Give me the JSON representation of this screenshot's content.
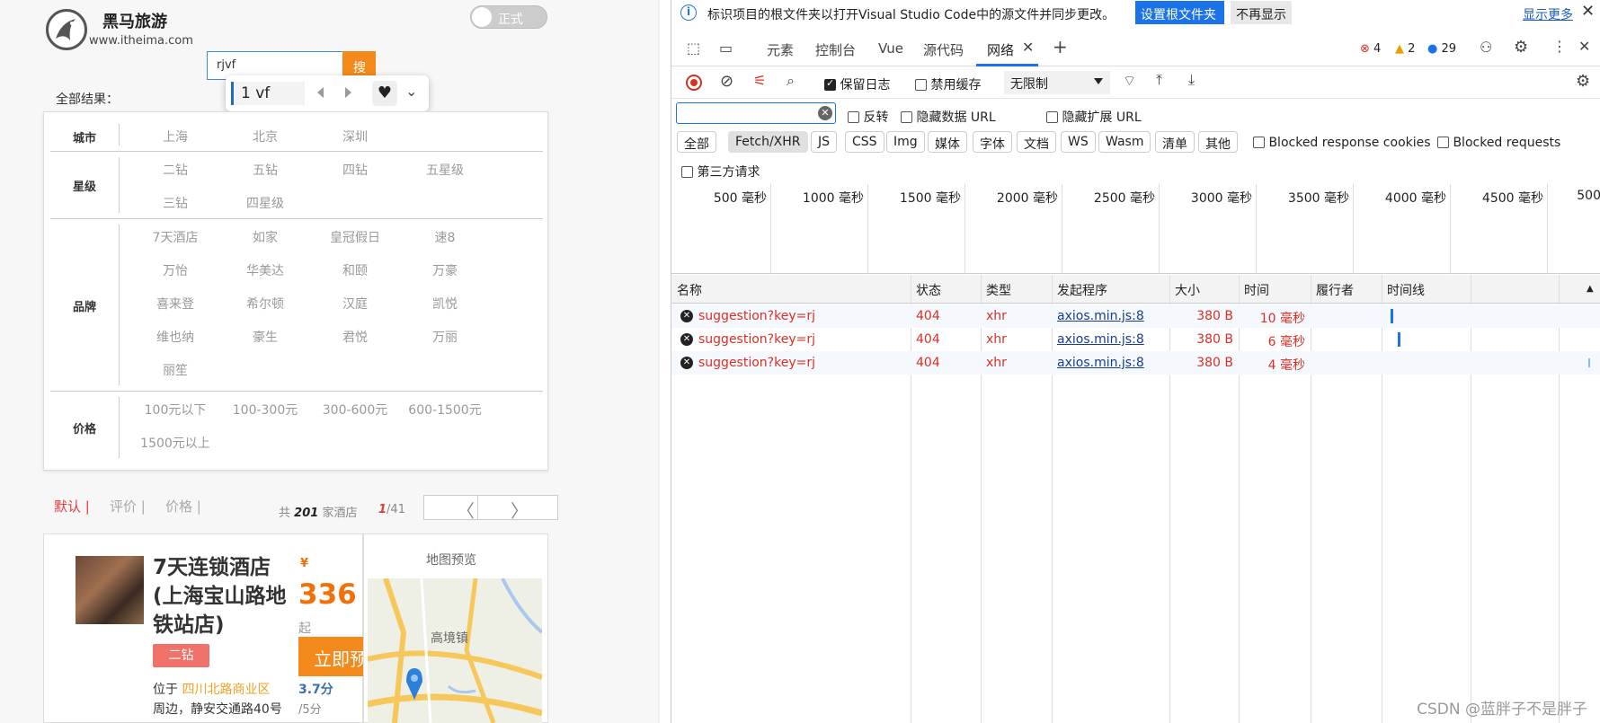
{
  "app": {
    "brand_name": "黑马旅游",
    "brand_url": "www.itheima.com",
    "toggle_label": "正式",
    "search_value": "rjvf",
    "search_button": "搜",
    "find_bar": {
      "text": "1 vf"
    },
    "result_label": "全部结果：",
    "filters": [
      {
        "name": "城市",
        "options": [
          "上海",
          "北京",
          "深圳"
        ]
      },
      {
        "name": "星级",
        "options": [
          "二钻",
          "五钻",
          "四钻",
          "五星级",
          "三钻",
          "四星级"
        ]
      },
      {
        "name": "品牌",
        "options": [
          "7天酒店",
          "如家",
          "皇冠假日",
          "速8",
          "万怡",
          "华美达",
          "和颐",
          "万豪",
          "喜来登",
          "希尔顿",
          "汉庭",
          "凯悦",
          "维也纳",
          "豪生",
          "君悦",
          "万丽",
          "丽笙"
        ]
      },
      {
        "name": "价格",
        "options": [
          "100元以下",
          "100-300元",
          "300-600元",
          "600-1500元",
          "1500元以上"
        ]
      }
    ],
    "sort": {
      "default": "默认 |",
      "rating": "评价 |",
      "price": "价格 |"
    },
    "count": {
      "prefix": "共",
      "total": "201",
      "suffix": "家酒店"
    },
    "pager": {
      "current": "1",
      "total": "/41"
    },
    "pager_prev": "〈",
    "pager_next": "〉",
    "hotel": {
      "name": "7天连锁酒店(上海宝山路地铁站店)",
      "star": "二钻",
      "address_prefix": "位于",
      "address_link": "四川北路商业区",
      "address_suffix": "周边，静安交通路40号",
      "currency": "¥",
      "price": "336",
      "price_suffix": "起",
      "book_button": "立即预",
      "score": "3.7分",
      "score_total": "/5分"
    },
    "map": {
      "title": "地图预览",
      "place": "高境镇"
    }
  },
  "devtools": {
    "info_text": "标识项目的根文件夹以打开Visual Studio Code中的源文件并同步更改。",
    "set_root_button": "设置根文件夹",
    "dismiss_button": "不再显示",
    "learn_more": "显示更多",
    "tabs": [
      "元素",
      "控制台",
      "Vue",
      "源代码",
      "网络"
    ],
    "counters": {
      "errors": "4",
      "warnings": "2",
      "messages": "29"
    },
    "preserve_log": "保留日志",
    "disable_cache": "禁用缓存",
    "throttle": "无限制",
    "filter_options": {
      "invert": "反转",
      "hide_data_urls": "隐藏数据 URL",
      "hide_ext_urls": "隐藏扩展 URL"
    },
    "type_chips": [
      "全部",
      "Fetch/XHR",
      "JS",
      "CSS",
      "Img",
      "媒体",
      "字体",
      "文档",
      "WS",
      "Wasm",
      "清单",
      "其他"
    ],
    "blocked_cookies": "Blocked response cookies",
    "blocked_requests": "Blocked requests",
    "third_party": "第三方请求",
    "timeline_ticks": [
      "500 毫秒",
      "1000 毫秒",
      "1500 毫秒",
      "2000 毫秒",
      "2500 毫秒",
      "3000 毫秒",
      "3500 毫秒",
      "4000 毫秒",
      "4500 毫秒",
      "500"
    ],
    "columns": [
      "名称",
      "状态",
      "类型",
      "发起程序",
      "大小",
      "时间",
      "履行者",
      "时间线"
    ],
    "requests": [
      {
        "name": "suggestion?key=rj",
        "status": "404",
        "type": "xhr",
        "initiator": "axios.min.js:8",
        "size": "380 B",
        "time": "10 毫秒"
      },
      {
        "name": "suggestion?key=rj",
        "status": "404",
        "type": "xhr",
        "initiator": "axios.min.js:8",
        "size": "380 B",
        "time": "6 毫秒"
      },
      {
        "name": "suggestion?key=rj",
        "status": "404",
        "type": "xhr",
        "initiator": "axios.min.js:8",
        "size": "380 B",
        "time": "4 毫秒"
      }
    ]
  },
  "watermark": "CSDN @蓝胖子不是胖子"
}
